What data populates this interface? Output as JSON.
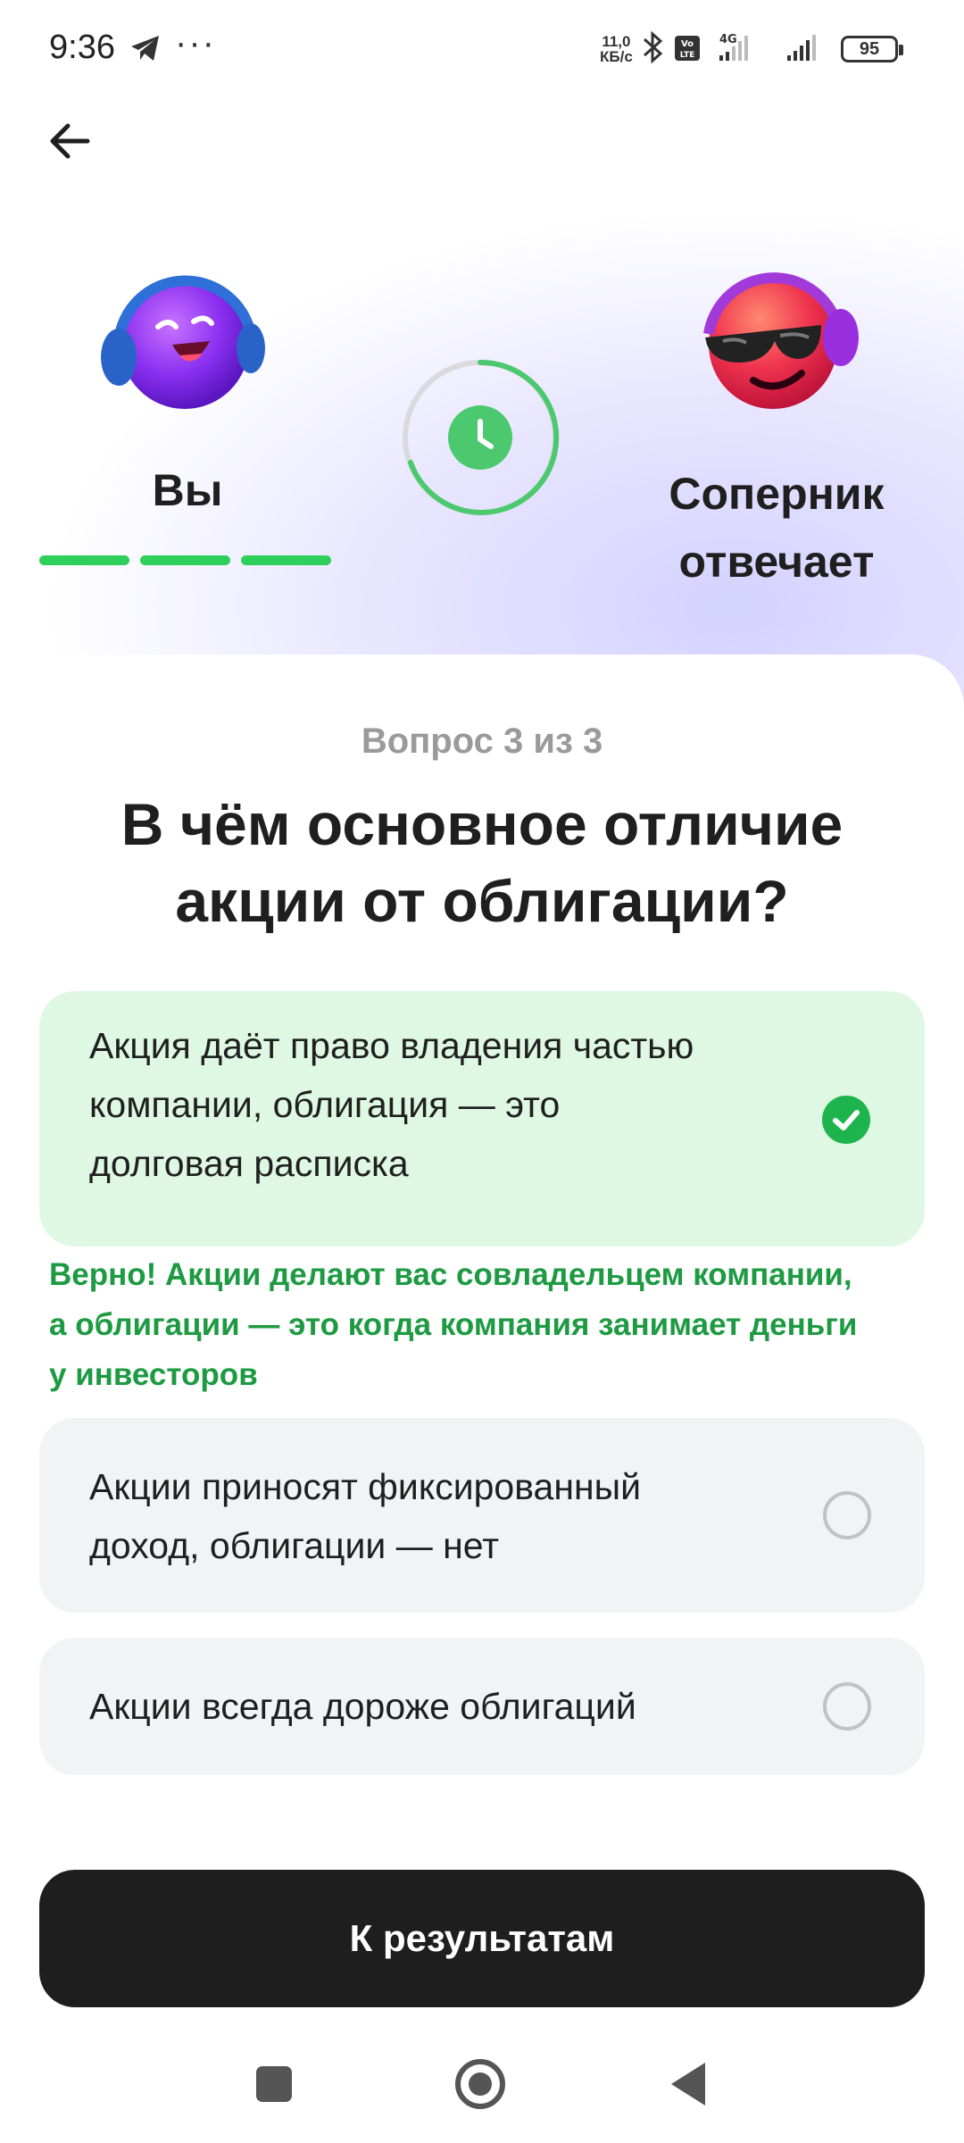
{
  "status_bar": {
    "time": "9:36",
    "speed_value": "11,0",
    "speed_unit": "КБ/с",
    "battery": "95",
    "icons": [
      "telegram-icon",
      "more-dots-icon",
      "bluetooth-icon",
      "volte-icon",
      "signal-4g-icon",
      "signal-icon",
      "battery-icon"
    ]
  },
  "players": {
    "you_label": "Вы",
    "opponent_label_line1": "Соперник",
    "opponent_label_line2": "отвечает",
    "you_progress_segments": 3
  },
  "question": {
    "counter": "Вопрос 3 из 3",
    "text_line1": "В чём основное отличие",
    "text_line2": "акции от облигации?"
  },
  "answers": [
    {
      "line1": "Акция даёт право владения частью",
      "line2": "компании, облигация — это",
      "line3": "долговая расписка",
      "state": "correct"
    },
    {
      "line1": "Акции приносят фиксированный",
      "line2": "доход, облигации — нет",
      "state": "unselected"
    },
    {
      "line1": "Акции всегда дороже облигаций",
      "state": "unselected"
    }
  ],
  "feedback": {
    "line1": "Верно! Акции делают вас совладельцем компании,",
    "line2": "а облигации — это когда компания занимает деньги",
    "line3": "у инвесторов"
  },
  "result_button": "К результатам",
  "colors": {
    "accent_green": "#2ecf5b",
    "correct_bg": "#dff8e3",
    "feedback_text": "#1d9a42",
    "button_bg": "#1e1e1e"
  }
}
